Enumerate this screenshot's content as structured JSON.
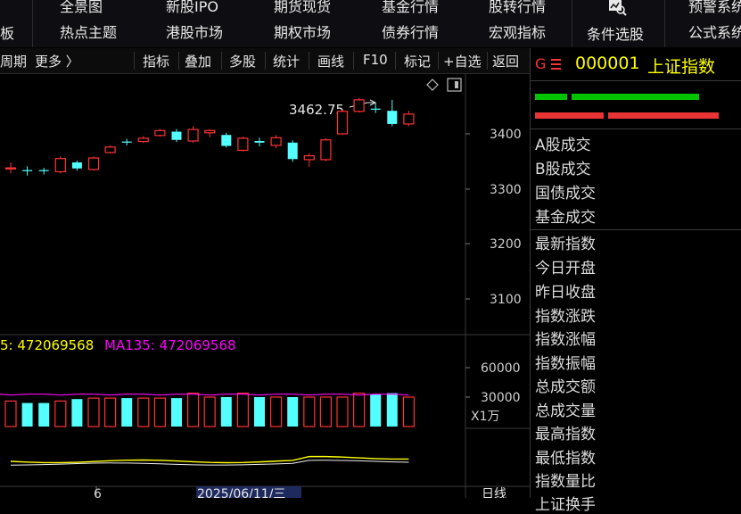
{
  "top_menu": {
    "row1": [
      "全景图",
      "新股IPO",
      "期货现货",
      "基金行情",
      "股转行情",
      "预警系统"
    ],
    "row2": [
      "热点主题",
      "港股市场",
      "期权市场",
      "债券行情",
      "宏观指标",
      "公式系统"
    ],
    "left_partial": "板",
    "condition_select": "条件选股",
    "condition_icon": "search-chart-icon"
  },
  "toolbar": {
    "period": "周期",
    "more": "更多 〉",
    "buttons": [
      "指标",
      "叠加",
      "多股",
      "统计",
      "画线",
      "F10",
      "标记",
      "+自选",
      "返回"
    ]
  },
  "chart": {
    "peak_label": "3462.75",
    "y_ticks": [
      "3400",
      "3300",
      "3200",
      "3100"
    ],
    "ma_label_prefix": "5: 472069568",
    "ma_label": "MA135: 472069568",
    "volume_ticks": [
      "60000",
      "30000"
    ],
    "volume_unit": "X1万",
    "date_label": "2025/06/11/三",
    "x_partial": "6",
    "bottom_right": "日线"
  },
  "right_panel": {
    "flag": "G",
    "code": "000001",
    "name": "上证指数",
    "labels_1": [
      "A股成交",
      "B股成交",
      "国债成交",
      "基金成交"
    ],
    "labels_2": [
      "最新指数",
      "今日开盘",
      "昨日收盘",
      "指数涨跌",
      "指数涨幅",
      "指数振幅",
      "总成交额",
      "总成交量",
      "最高指数",
      "最低指数",
      "指数量比",
      "上证换手"
    ]
  },
  "colors": {
    "up": "#ff3232",
    "down": "#54ffff",
    "ma_yellow": "#ffff00",
    "ma_magenta": "#ff00ff",
    "code_yellow": "#ffff00"
  },
  "chart_data": {
    "type": "candlestick",
    "y_unit": "index points",
    "candles": [
      {
        "o": 3338,
        "c": 3338,
        "h": 3348,
        "l": 3328
      },
      {
        "o": 3334,
        "c": 3332,
        "h": 3341,
        "l": 3324
      },
      {
        "o": 3334,
        "c": 3332,
        "h": 3338,
        "l": 3326
      },
      {
        "o": 3331,
        "c": 3355,
        "h": 3359,
        "l": 3328
      },
      {
        "o": 3348,
        "c": 3337,
        "h": 3351,
        "l": 3333
      },
      {
        "o": 3335,
        "c": 3356,
        "h": 3359,
        "l": 3333
      },
      {
        "o": 3366,
        "c": 3376,
        "h": 3379,
        "l": 3364
      },
      {
        "o": 3386,
        "c": 3384,
        "h": 3391,
        "l": 3379
      },
      {
        "o": 3386,
        "c": 3392,
        "h": 3396,
        "l": 3384
      },
      {
        "o": 3397,
        "c": 3406,
        "h": 3409,
        "l": 3395
      },
      {
        "o": 3404,
        "c": 3389,
        "h": 3409,
        "l": 3385
      },
      {
        "o": 3387,
        "c": 3408,
        "h": 3414,
        "l": 3384
      },
      {
        "o": 3402,
        "c": 3406,
        "h": 3409,
        "l": 3394
      },
      {
        "o": 3398,
        "c": 3378,
        "h": 3402,
        "l": 3375
      },
      {
        "o": 3370,
        "c": 3392,
        "h": 3395,
        "l": 3368
      },
      {
        "o": 3387,
        "c": 3384,
        "h": 3393,
        "l": 3377
      },
      {
        "o": 3379,
        "c": 3393,
        "h": 3398,
        "l": 3374
      },
      {
        "o": 3384,
        "c": 3354,
        "h": 3388,
        "l": 3349
      },
      {
        "o": 3353,
        "c": 3360,
        "h": 3365,
        "l": 3340
      },
      {
        "o": 3353,
        "c": 3389,
        "h": 3392,
        "l": 3350
      },
      {
        "o": 3400,
        "c": 3441,
        "h": 3444,
        "l": 3398
      },
      {
        "o": 3441,
        "c": 3462,
        "h": 3465,
        "l": 3439
      },
      {
        "o": 3446,
        "c": 3444,
        "h": 3456,
        "l": 3438
      },
      {
        "o": 3442,
        "c": 3418,
        "h": 3462,
        "l": 3414
      },
      {
        "o": 3418,
        "c": 3436,
        "h": 3442,
        "l": 3414
      }
    ],
    "volume": [
      26,
      24,
      24,
      26,
      28,
      29,
      29,
      29,
      29,
      29,
      29,
      34,
      30,
      30,
      34,
      30,
      30,
      30,
      30,
      30,
      30,
      34,
      33,
      34,
      30
    ],
    "ma_volume": 33,
    "volume_ylim": [
      0,
      70000
    ],
    "price_ylim": [
      3040,
      3490
    ]
  }
}
